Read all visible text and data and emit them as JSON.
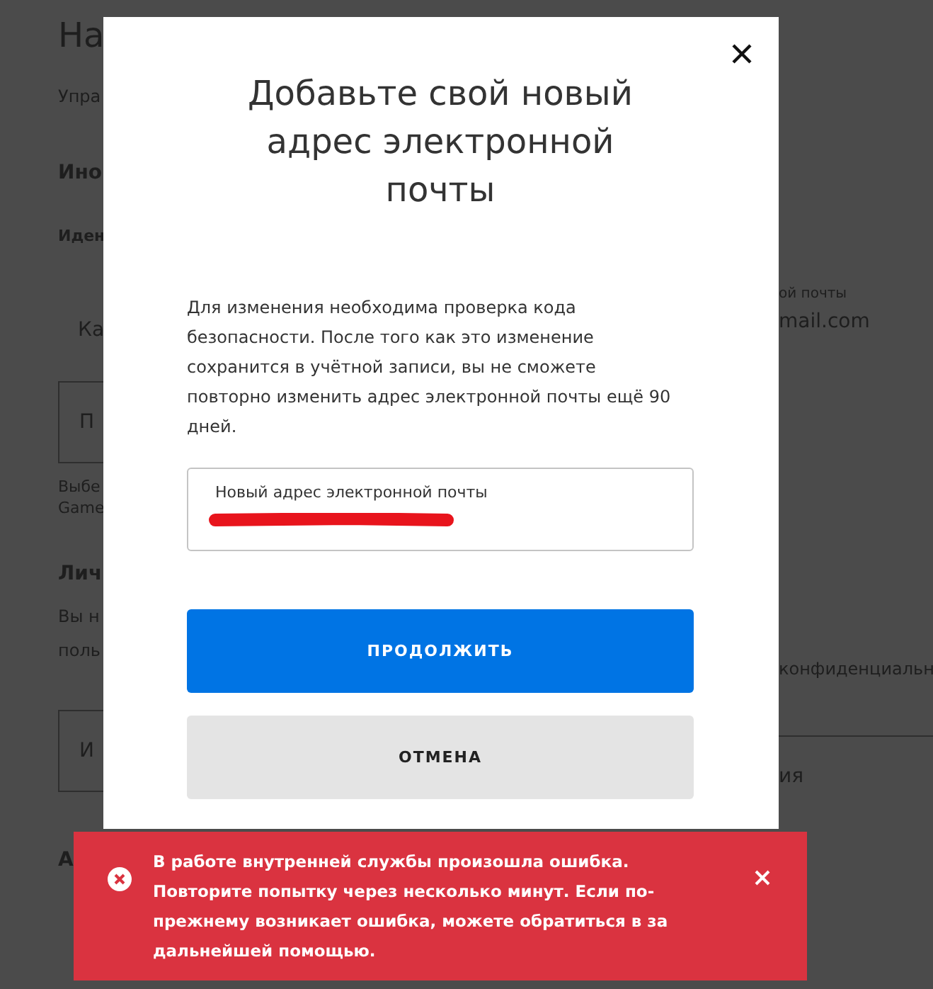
{
  "background_page": {
    "left_fragments": [
      {
        "kind": "title",
        "text": "На"
      },
      {
        "kind": "text",
        "text": "Упра"
      },
      {
        "kind": "heading",
        "text": "Ино"
      },
      {
        "kind": "subheading",
        "text": "Иден"
      },
      {
        "kind": "field",
        "text": "Ка"
      },
      {
        "kind": "button",
        "text": "П"
      },
      {
        "kind": "small",
        "text": "Выбе"
      },
      {
        "kind": "small",
        "text": "Game"
      },
      {
        "kind": "heading",
        "text": "Лич"
      },
      {
        "kind": "text",
        "text": "Вы н"
      },
      {
        "kind": "text",
        "text": "поль"
      },
      {
        "kind": "button",
        "text": "И"
      },
      {
        "kind": "heading",
        "text": "А"
      }
    ],
    "right_fragments": [
      {
        "kind": "label",
        "text": "ой почты"
      },
      {
        "kind": "field",
        "text": "mail.com"
      },
      {
        "kind": "text",
        "text": "конфиденциальн"
      },
      {
        "kind": "button",
        "text": "ия"
      }
    ]
  },
  "modal": {
    "title": "Добавьте свой новый адрес электронной почты",
    "description": "Для изменения необходима проверка кода безопасности. После того как это изменение сохранится в учётной записи, вы не сможете повторно изменить адрес электронной почты ещё 90 дней.",
    "email_field": {
      "label": "Новый адрес электронной почты",
      "redacted": true
    },
    "buttons": [
      {
        "label": "ПРОДОЛЖИТЬ",
        "kind": "primary"
      },
      {
        "label": "ОТМЕНА",
        "kind": "secondary"
      }
    ]
  },
  "error_toast": {
    "message": "В работе внутренней службы произошла ошибка. Повторите попытку через несколько минут. Если по-прежнему возникает ошибка, можете обратиться в за дальнейшей помощью."
  }
}
